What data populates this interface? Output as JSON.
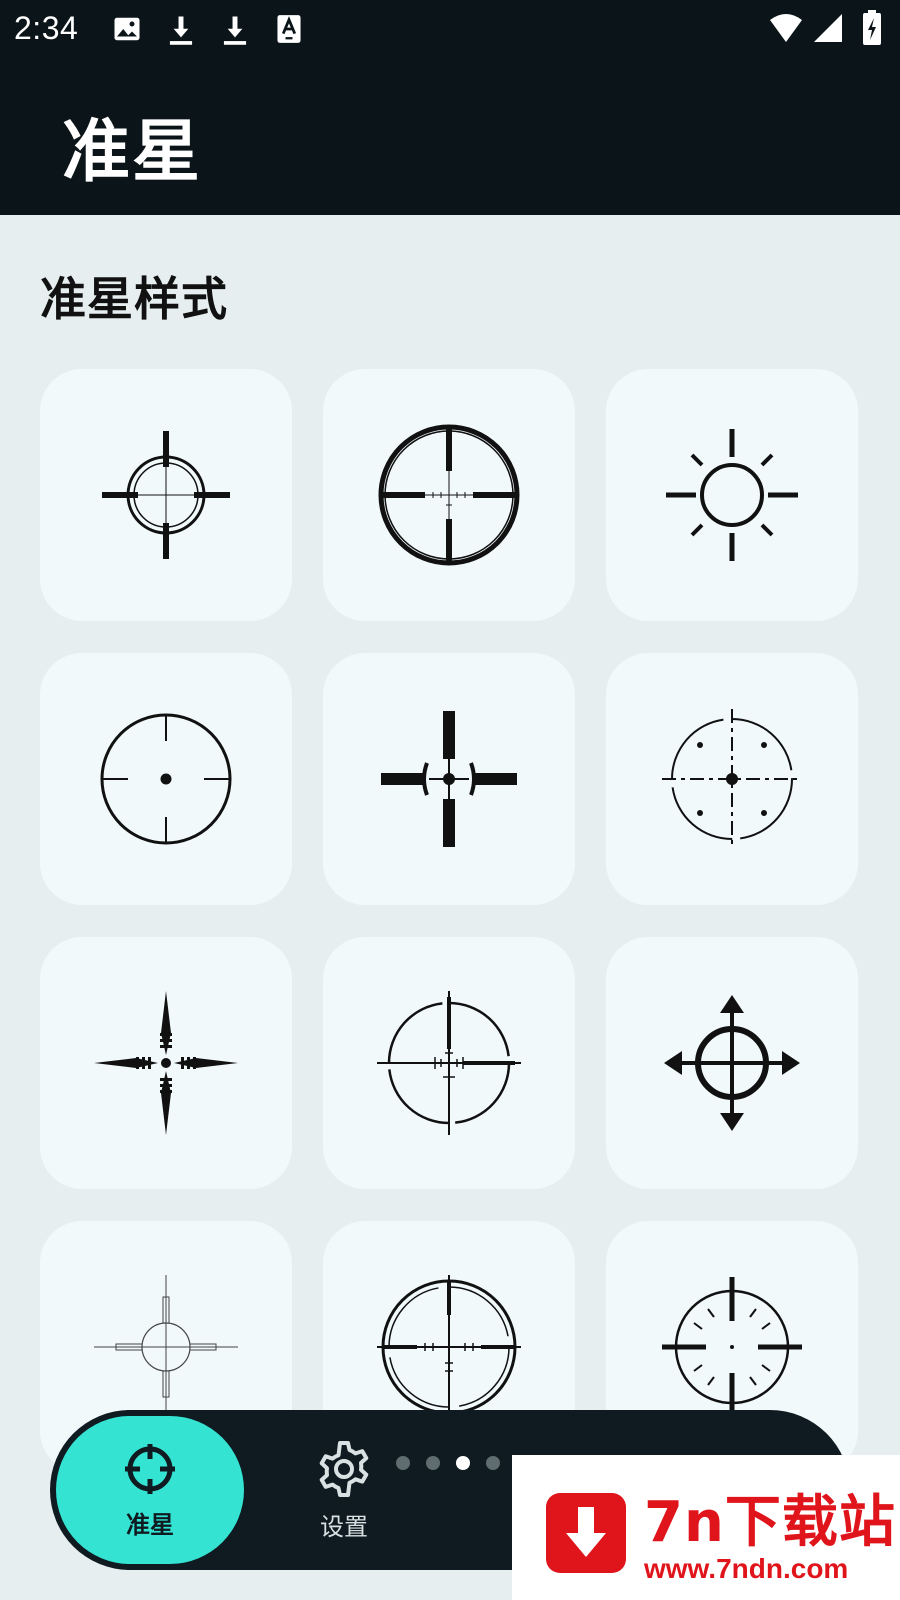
{
  "status_bar": {
    "time": "2:34",
    "icons": [
      "image-icon",
      "download-icon",
      "download-icon",
      "font-a-icon",
      "wifi-icon",
      "signal-icon",
      "battery-charging-icon"
    ]
  },
  "app_bar": {
    "title": "准星"
  },
  "section": {
    "title": "准星样式"
  },
  "crosshairs": [
    {
      "style": "circle-cross-thick"
    },
    {
      "style": "scope-ring-bold"
    },
    {
      "style": "sun-rays"
    },
    {
      "style": "circle-dot"
    },
    {
      "style": "heavy-cross-dot"
    },
    {
      "style": "dashed-circle-dots"
    },
    {
      "style": "spiked-cross"
    },
    {
      "style": "broken-circle-scope"
    },
    {
      "style": "arrow-circle"
    },
    {
      "style": "thin-scope-light"
    },
    {
      "style": "double-ring-scope"
    },
    {
      "style": "tick-circle"
    }
  ],
  "bottom_nav": {
    "items": [
      {
        "label": "准星",
        "icon": "crosshair-icon",
        "active": true
      },
      {
        "label": "设置",
        "icon": "gear-icon",
        "active": false
      }
    ],
    "page_dots": {
      "count": 4,
      "active_index": 2
    }
  },
  "watermark": {
    "title": "7n下载站",
    "url": "www.7ndn.com"
  },
  "colors": {
    "accent": "#34e3d2",
    "dark": "#0b1418",
    "tile": "#f1f9fb",
    "background": "#e6eef0",
    "watermark": "#e0141b"
  }
}
